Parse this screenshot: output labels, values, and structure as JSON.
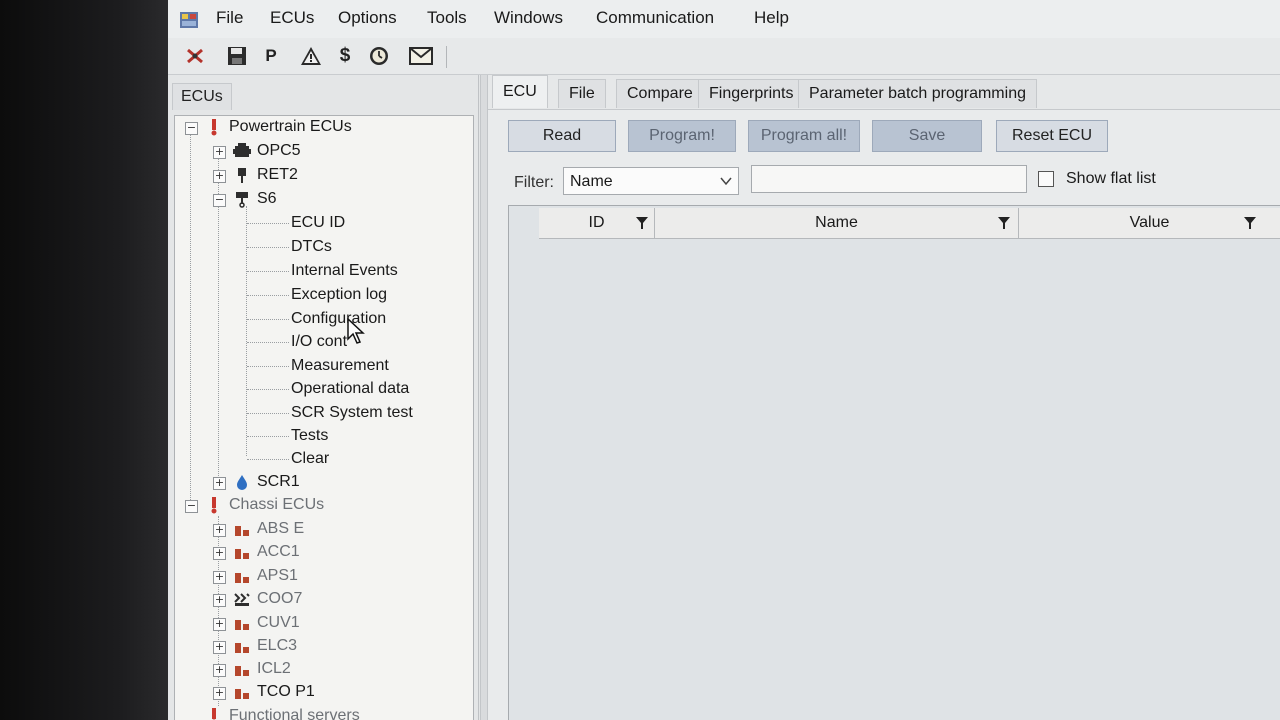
{
  "menu": [
    "File",
    "ECUs",
    "Options",
    "Tools",
    "Windows",
    "Communication",
    "Help"
  ],
  "toolbar": {
    "p_label": "P",
    "dollar_label": "$"
  },
  "left_panel": {
    "tab": "ECUs",
    "tree": {
      "powertrain": "Powertrain ECUs",
      "opc5": "OPC5",
      "ret2": "RET2",
      "s6": "S6",
      "s6_children": [
        "ECU ID",
        "DTCs",
        "Internal Events",
        "Exception log",
        "Configuration",
        "I/O cont",
        "Measurement",
        "Operational data",
        "SCR System test",
        "Tests",
        "Clear"
      ],
      "scr1": "SCR1",
      "chassi": "Chassi ECUs",
      "chassi_children": [
        "ABS E",
        "ACC1",
        "APS1",
        "COO7",
        "CUV1",
        "ELC3",
        "ICL2",
        "TCO P1"
      ],
      "functional": "Functional servers"
    }
  },
  "right_panel": {
    "tabs": [
      "ECU",
      "File",
      "Compare",
      "Fingerprints",
      "Parameter batch programming"
    ],
    "buttons": {
      "read": "Read",
      "program": "Program!",
      "program_all": "Program all!",
      "save": "Save",
      "reset": "Reset ECU"
    },
    "filter": {
      "label": "Filter:",
      "selected": "Name",
      "text": ""
    },
    "show_flat_list": "Show flat list",
    "columns": [
      "ID",
      "Name",
      "Value"
    ]
  },
  "colors": {
    "button_enabled": "#d7dce3",
    "button_disabled": "#b8c3d2",
    "tree_bg": "#f4f4f2"
  }
}
